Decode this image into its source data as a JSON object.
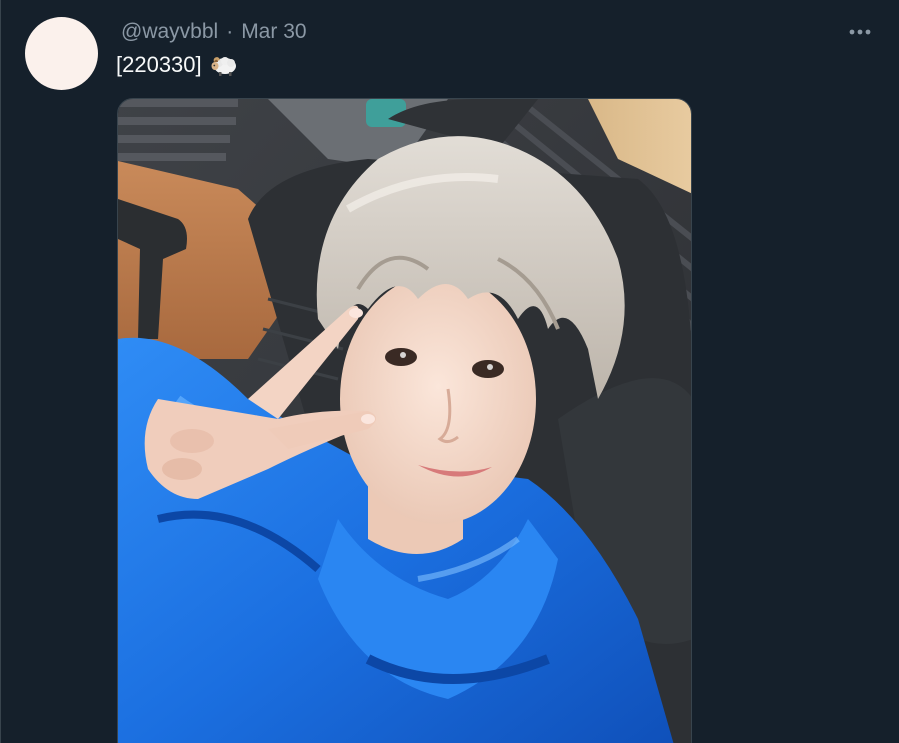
{
  "tweet": {
    "handle": "@wayvbbl",
    "separator": "·",
    "date": "Mar 30",
    "text": "[220330]",
    "emoji": "ram-emoji",
    "more_icon": "more-horizontal-icon",
    "media_description_icon": "selfie-photo"
  },
  "colors": {
    "background": "#15202b",
    "secondary_text": "#8b98a5",
    "primary_text": "#f7f9f9",
    "avatar": "#fbf1ec",
    "jacket": "#1b72e8"
  }
}
